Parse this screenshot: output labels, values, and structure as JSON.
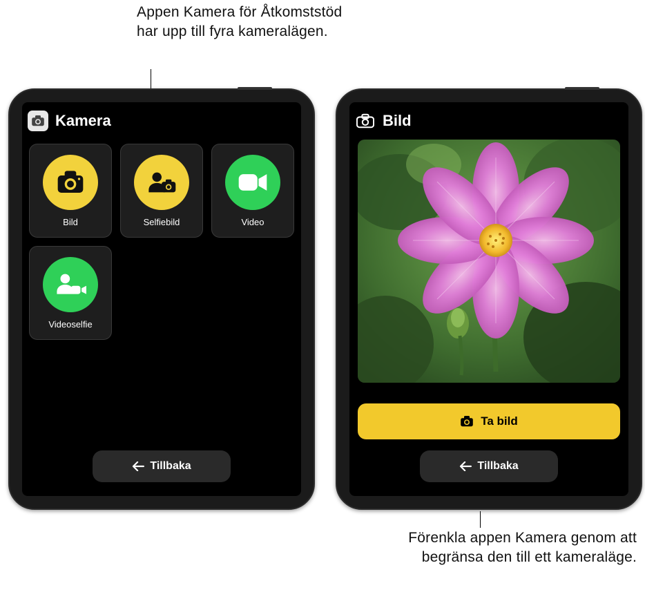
{
  "annotations": {
    "top": "Appen Kamera för Åtkomststöd har upp till fyra kameralägen.",
    "bottom": "Förenkla appen Kamera genom att begränsa den till ett kameraläge."
  },
  "left": {
    "header_title": "Kamera",
    "modes": {
      "photo": "Bild",
      "selfie_photo": "Selfiebild",
      "video": "Video",
      "selfie_video": "Videoselfie"
    },
    "back_label": "Tillbaka"
  },
  "right": {
    "header_title": "Bild",
    "take_photo_label": "Ta bild",
    "back_label": "Tillbaka"
  },
  "icons": {
    "camera": "camera-icon",
    "selfie_camera": "selfie-camera-icon",
    "video": "video-icon",
    "selfie_video": "selfie-video-icon",
    "back_arrow": "arrow-left-icon"
  },
  "colors": {
    "yellow": "#f2d23c",
    "green": "#2fd058",
    "take_photo_yellow": "#f2c92c"
  }
}
